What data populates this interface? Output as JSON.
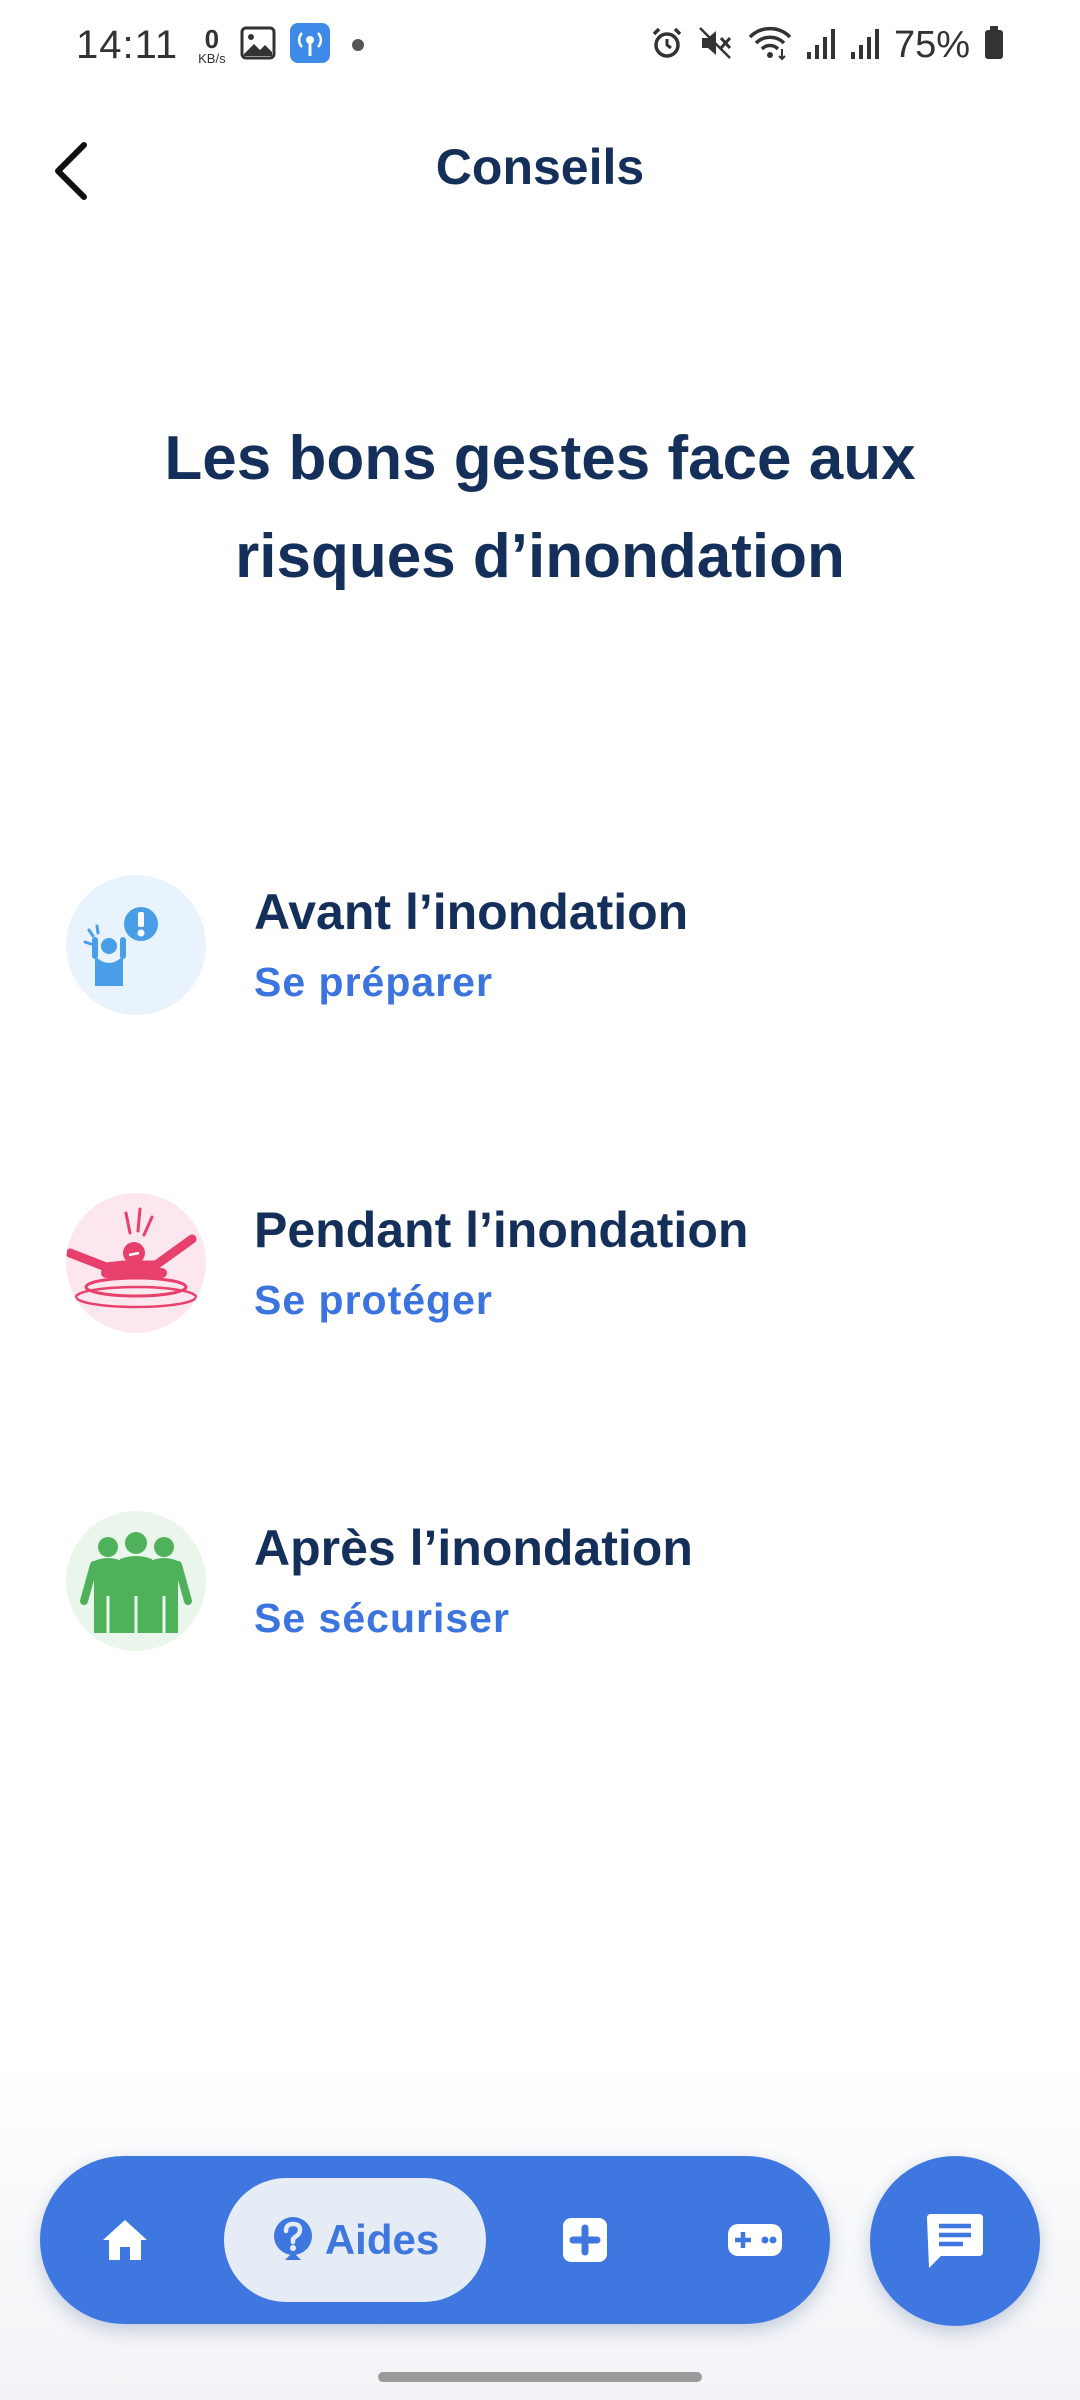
{
  "status_bar": {
    "time": "14:11",
    "net_speed_value": "0",
    "net_speed_unit": "KB/s",
    "battery": "75%"
  },
  "app_bar": {
    "title": "Conseils"
  },
  "page": {
    "heading": "Les bons gestes face aux risques d’inondation"
  },
  "advice_items": [
    {
      "title": "Avant l’inondation",
      "subtitle": "Se préparer",
      "icon": "person-alert-icon",
      "color": "#4a9ee8",
      "bg": "#e9f3fd"
    },
    {
      "title": "Pendant l’inondation",
      "subtitle": "Se protéger",
      "icon": "drowning-person-icon",
      "color": "#e8406d",
      "bg": "#fde7ee"
    },
    {
      "title": "Après l’inondation",
      "subtitle": "Se sécuriser",
      "icon": "group-people-icon",
      "color": "#4fb25a",
      "bg": "#eaf6ec"
    }
  ],
  "bottom_nav": {
    "items": [
      {
        "icon": "home-icon"
      },
      {
        "icon": "help-icon",
        "label": "Aides",
        "active": true
      },
      {
        "icon": "medical-plus-icon"
      },
      {
        "icon": "gamepad-icon"
      }
    ],
    "chat_icon": "chat-icon",
    "accent": "#3d77df"
  }
}
